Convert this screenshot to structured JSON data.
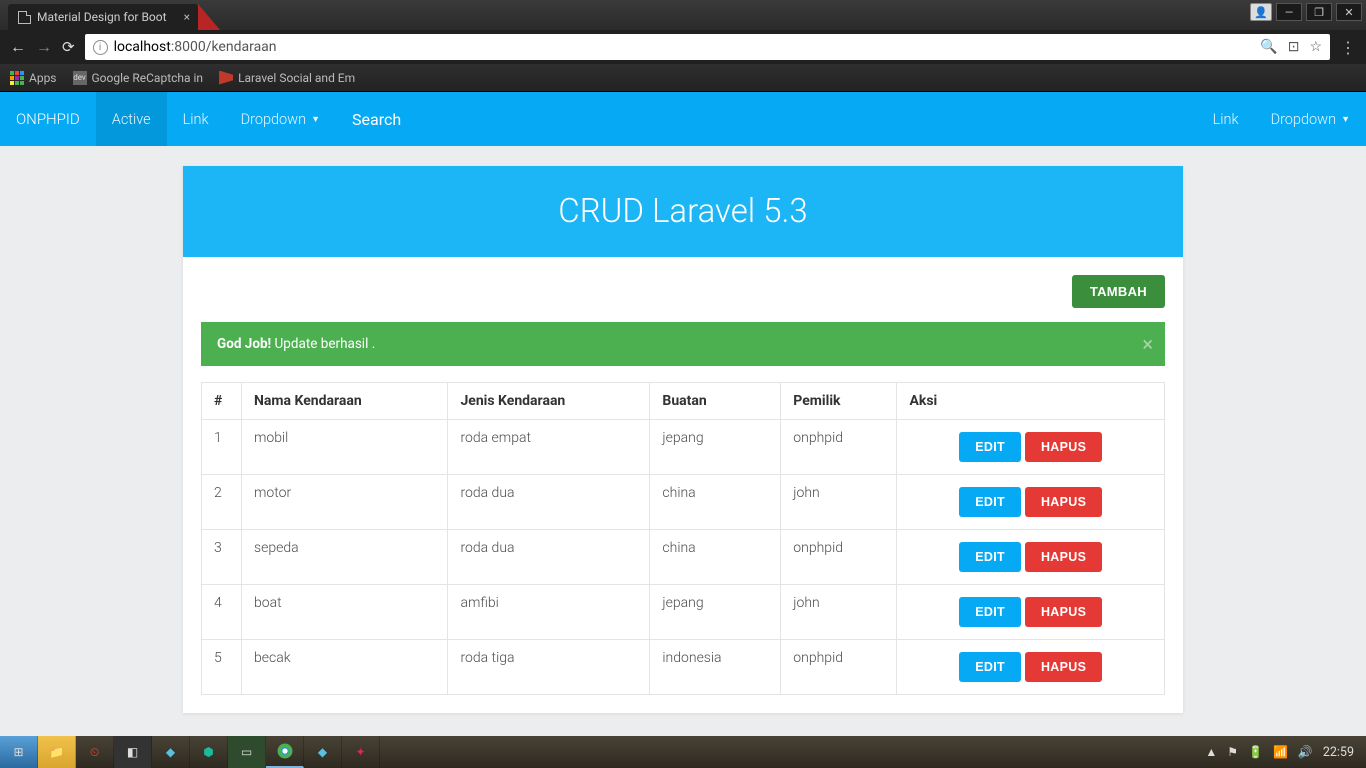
{
  "browser": {
    "tab_title": "Material Design for Boot",
    "url_host": "localhost",
    "url_path": ":8000/kendaraan",
    "bookmarks": {
      "apps": "Apps",
      "item1": "Google ReCaptcha in",
      "item2": "Laravel Social and Em"
    }
  },
  "nav": {
    "brand": "ONPHPID",
    "active": "Active",
    "link": "Link",
    "dropdown": "Dropdown",
    "search": "Search",
    "right_link": "Link",
    "right_dropdown": "Dropdown"
  },
  "page": {
    "hero": "CRUD Laravel 5.3",
    "add_label": "TAMBAH",
    "alert_strong": "God Job!",
    "alert_text": " Update berhasil .",
    "headers": [
      "#",
      "Nama Kendaraan",
      "Jenis Kendaraan",
      "Buatan",
      "Pemilik",
      "Aksi"
    ],
    "edit_label": "EDIT",
    "delete_label": "HAPUS",
    "rows": [
      {
        "n": "1",
        "nama": "mobil",
        "jenis": "roda empat",
        "buatan": "jepang",
        "pemilik": "onphpid"
      },
      {
        "n": "2",
        "nama": "motor",
        "jenis": "roda dua",
        "buatan": "china",
        "pemilik": "john"
      },
      {
        "n": "3",
        "nama": "sepeda",
        "jenis": "roda dua",
        "buatan": "china",
        "pemilik": "onphpid"
      },
      {
        "n": "4",
        "nama": "boat",
        "jenis": "amfibi",
        "buatan": "jepang",
        "pemilik": "john"
      },
      {
        "n": "5",
        "nama": "becak",
        "jenis": "roda tiga",
        "buatan": "indonesia",
        "pemilik": "onphpid"
      }
    ]
  },
  "taskbar": {
    "clock": "22:59"
  }
}
